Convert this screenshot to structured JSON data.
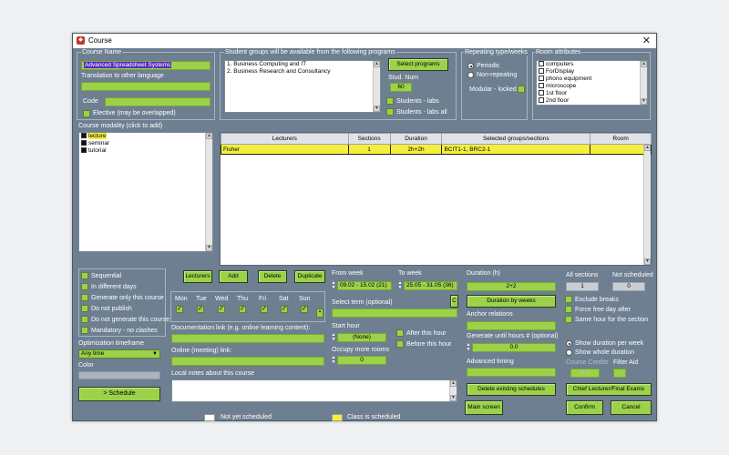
{
  "window": {
    "title": "Course",
    "close": "✕"
  },
  "course_name": {
    "group_label": "Course Name",
    "value": "Advanced Spreadsheet Systems",
    "translation_label": "Translation to other language",
    "code_label": "Code",
    "elective_label": "Elective (may be overlapped)"
  },
  "student_groups": {
    "group_label": "Student groups will be available from the following programs",
    "programs": [
      "1. Business Computing and IT",
      "2. Business Research and Consultancy"
    ],
    "select_button": "Select programs",
    "stud_num_label": "Stud. Num",
    "stud_num_value": "60",
    "students_labs": "Students - labs",
    "students_labs_all": "Students - labs all"
  },
  "repeating": {
    "group_label": "Repeating type/weeks",
    "periodic": "Periodic",
    "non_repeating": "Non-repeating",
    "modular_locked": "Modular - locked"
  },
  "room_attributes": {
    "group_label": "Room attributes",
    "items": [
      "computers",
      "ForDisplay",
      "phono equipment",
      "microscope",
      "1st floor",
      "2nd floor"
    ]
  },
  "modality": {
    "label": "Course modality (click to add)",
    "items": [
      "lecture",
      "seminar",
      "tutorial"
    ]
  },
  "grid": {
    "headers": [
      "Lecturers",
      "Sections",
      "Duration",
      "Selected groups/sections",
      "Room"
    ],
    "rows": [
      {
        "lecturer": "Fisher",
        "sections": "1",
        "duration": "2h+2h",
        "groups": "BCIT1-1, BRC2-1",
        "room": ""
      }
    ]
  },
  "options": {
    "sequential": "Sequential",
    "different_days": "In different days",
    "generate_only": "Generate only this course",
    "do_not_publish": "Do not publish",
    "do_not_generate": "Do not generate this course",
    "mandatory": "Mandatory - no clashes"
  },
  "optimization": {
    "label": "Optimization timeframe",
    "value": "Any time",
    "color_label": "Color"
  },
  "schedule_button": "> Schedule",
  "toolbar": {
    "lecturers": "Lecturers",
    "add": "Add",
    "delete": "Delete",
    "duplicate": "Duplicate"
  },
  "days": [
    "Mon",
    "Tue",
    "Wed",
    "Thu",
    "Fri",
    "Sat",
    "Sun"
  ],
  "links": {
    "doc_label": "Documentation link (e.g. online learning content):",
    "online_label": "Online (meeting) link:",
    "notes_label": "Local notes about this course"
  },
  "weeks": {
    "from_label": "From week",
    "from_value": "09.02 - 15.02 (21)",
    "to_label": "To week",
    "to_value": "25.05 - 31.05 (36)",
    "term_label": "Select term (optional)",
    "term_btn": "C",
    "start_hour_label": "Start hour",
    "start_hour_value": "(None)",
    "after_hour": "After this hour",
    "before_hour": "Before this hour",
    "occupy_label": "Occupy more rooms",
    "occupy_value": "0"
  },
  "duration": {
    "label": "Duration (h)",
    "value": "2+2",
    "by_weeks_button": "Duration by weeks",
    "anchor_label": "Anchor relations",
    "generate_until_label": "Generate until hours # (optional)",
    "generate_until_value": "0.0",
    "advanced_label": "Advanced timing"
  },
  "summary": {
    "all_sections_label": "All sections",
    "all_sections_value": "1",
    "not_scheduled_label": "Not scheduled",
    "not_scheduled_value": "0",
    "exclude_breaks": "Exclude breaks",
    "force_free_day": "Force free day after",
    "same_hour": "Same hour for the section",
    "show_per_week": "Show duration per week",
    "show_whole": "Show whole duration",
    "course_credits_label": "Course Credits",
    "course_credits_value": "0.0",
    "filter_aid_label": "Filter Aid"
  },
  "bottom": {
    "delete_existing": "Delete existing schedules",
    "chief_lecturer": "Chief Lecturer/Final Exams",
    "main_screen": "Main screen",
    "confirm": "Confirm",
    "cancel": "Cancel"
  },
  "legend": {
    "not_yet": "Not yet scheduled",
    "scheduled": "Class is scheduled"
  },
  "colors": {
    "window_bg": "#6d7f91",
    "field_green": "#9bd24a",
    "scheduled_yellow": "#f5ef3c",
    "selection_purple": "#5a2dbe"
  }
}
